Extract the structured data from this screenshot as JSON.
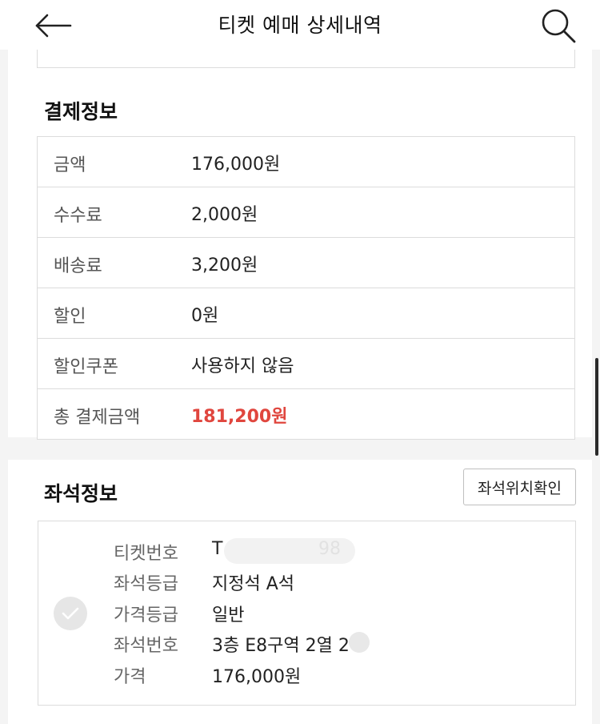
{
  "header": {
    "title": "티켓 예매 상세내역",
    "back_icon": "arrow-left-icon",
    "search_icon": "magnifier-icon"
  },
  "payment": {
    "section_title": "결제정보",
    "rows": [
      {
        "label": "금액",
        "value": "176,000원"
      },
      {
        "label": "수수료",
        "value": "2,000원"
      },
      {
        "label": "배송료",
        "value": "3,200원"
      },
      {
        "label": "할인",
        "value": "0원"
      },
      {
        "label": "할인쿠폰",
        "value": "사용하지 않음"
      },
      {
        "label": "총 결제금액",
        "value": "181,200원"
      }
    ],
    "total_color": "#e0463e"
  },
  "seat": {
    "section_title": "좌석정보",
    "location_button": "좌석위치확인",
    "check_icon": "check-icon",
    "ticket_number_label": "티켓번호",
    "ticket_number_prefix": "T",
    "ticket_number_suffix": "98",
    "grade_label": "좌석등급",
    "grade_value": "지정석 A석",
    "price_grade_label": "가격등급",
    "price_grade_value": "일반",
    "seat_number_label": "좌석번호",
    "seat_number_value": "3층 E8구역 2열 2",
    "price_label": "가격",
    "price_value": "176,000원"
  }
}
